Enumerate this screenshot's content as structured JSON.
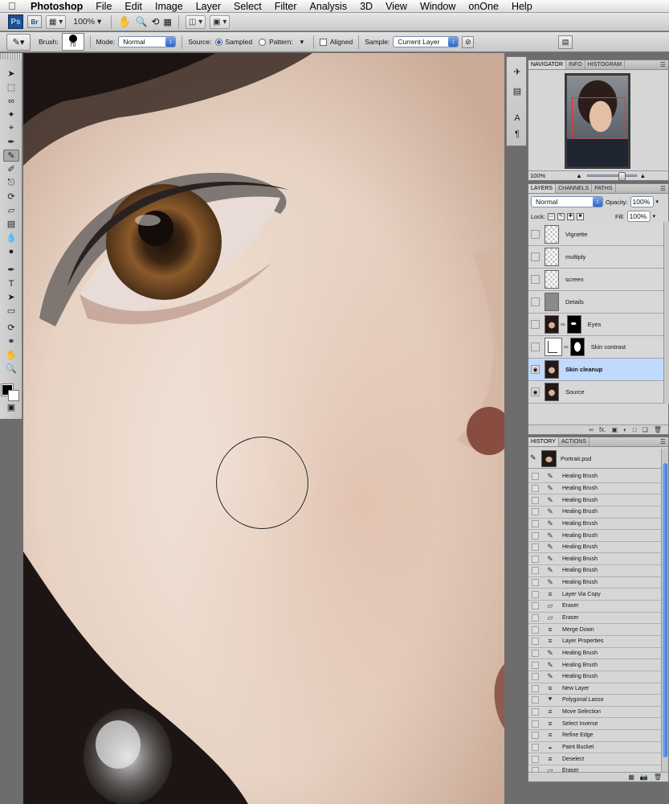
{
  "menubar": {
    "apple_icon": "apple-icon",
    "items": [
      "Photoshop",
      "File",
      "Edit",
      "Image",
      "Layer",
      "Select",
      "Filter",
      "Analysis",
      "3D",
      "View",
      "Window",
      "onOne",
      "Help"
    ]
  },
  "appbar": {
    "ps_logo": "Ps",
    "br_logo": "Br",
    "zoom": "100%"
  },
  "options": {
    "brush_label": "Brush:",
    "brush_size": "70",
    "mode_label": "Mode:",
    "mode_value": "Normal",
    "source_label": "Source:",
    "sampled_label": "Sampled",
    "pattern_label": "Pattern:",
    "aligned_label": "Aligned",
    "sample_label": "Sample:",
    "sample_value": "Current Layer"
  },
  "navigator": {
    "tabs": [
      "NAVIGATOR",
      "INFO",
      "HISTOGRAM"
    ],
    "zoom": "100%"
  },
  "layers_panel": {
    "tabs": [
      "LAYERS",
      "CHANNELS",
      "PATHS"
    ],
    "blend_mode": "Normal",
    "opacity_label": "Opacity:",
    "opacity_value": "100%",
    "lock_label": "Lock:",
    "fill_label": "Fill:",
    "fill_value": "100%",
    "layers": [
      {
        "name": "Vignette",
        "visible": false,
        "selected": false
      },
      {
        "name": "multiply",
        "visible": false,
        "selected": false
      },
      {
        "name": "screen",
        "visible": false,
        "selected": false
      },
      {
        "name": "Details",
        "visible": false,
        "selected": false
      },
      {
        "name": "Eyes",
        "visible": false,
        "selected": false
      },
      {
        "name": "Skin contrast",
        "visible": false,
        "selected": false
      },
      {
        "name": "Skin cleanup",
        "visible": true,
        "selected": true
      },
      {
        "name": "Source",
        "visible": true,
        "selected": false
      }
    ]
  },
  "history_panel": {
    "tabs": [
      "HISTORY",
      "ACTIONS"
    ],
    "snapshot": "Portrait.psd",
    "items": [
      "Healing Brush",
      "Healing Brush",
      "Healing Brush",
      "Healing Brush",
      "Healing Brush",
      "Healing Brush",
      "Healing Brush",
      "Healing Brush",
      "Healing Brush",
      "Healing Brush",
      "Layer Via Copy",
      "Eraser",
      "Eraser",
      "Merge Down",
      "Layer Properties",
      "Healing Brush",
      "Healing Brush",
      "Healing Brush",
      "New Layer",
      "Polygonal Lasso",
      "Move Selection",
      "Select Inverse",
      "Refine Edge",
      "Paint Bucket",
      "Deselect",
      "Eraser"
    ]
  },
  "colors": {
    "selection_blue": "#bfd9ff",
    "navigator_rect": "#ff2a2a",
    "skin": "#ead9cd"
  }
}
